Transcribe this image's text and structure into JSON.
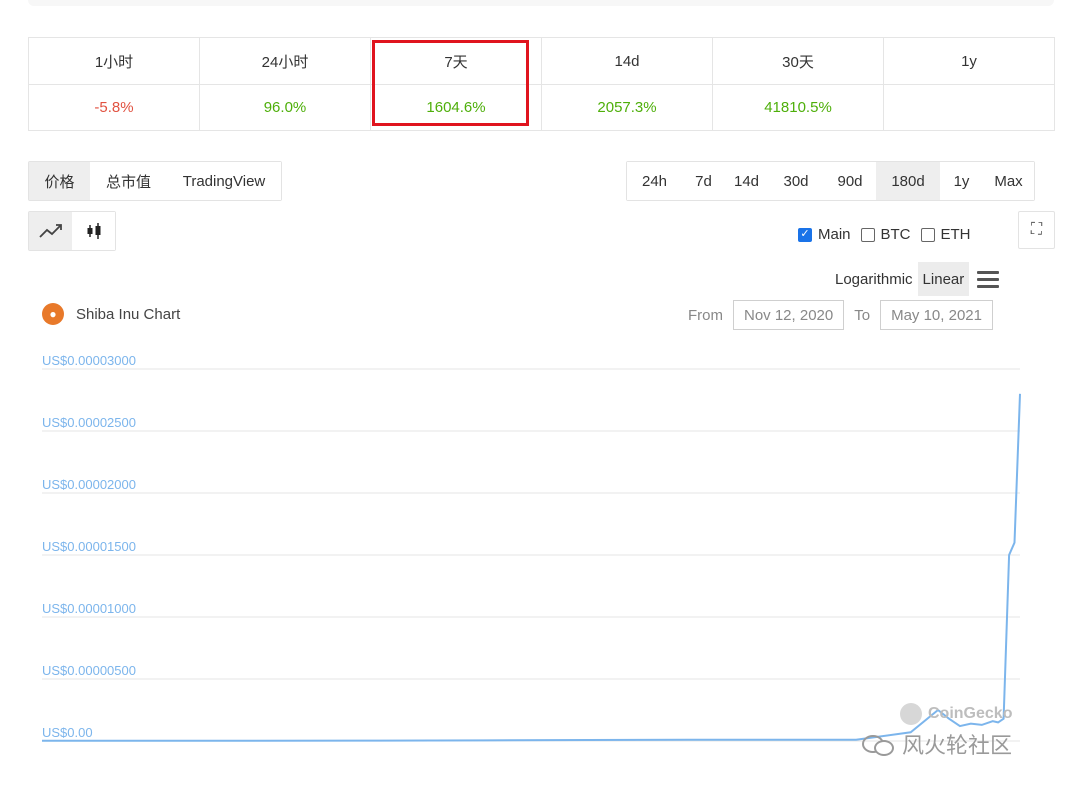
{
  "change_table": {
    "headers": [
      "1小时",
      "24小时",
      "7天",
      "14d",
      "30天",
      "1y"
    ],
    "values": [
      "-5.8%",
      "96.0%",
      "1604.6%",
      "2057.3%",
      "41810.5%",
      ""
    ]
  },
  "view_tabs": [
    "价格",
    "总市值",
    "TradingView"
  ],
  "range_tabs": [
    "24h",
    "7d",
    "14d",
    "30d",
    "90d",
    "180d",
    "1y",
    "Max"
  ],
  "range_active": "180d",
  "compare": {
    "main": "Main",
    "btc": "BTC",
    "eth": "ETH"
  },
  "scale": {
    "log": "Logarithmic",
    "linear": "Linear"
  },
  "chart_title": "Shiba Inu Chart",
  "date_range": {
    "from_label": "From",
    "from": "Nov 12, 2020",
    "to_label": "To",
    "to": "May 10, 2021"
  },
  "watermarks": {
    "coingecko": "CoinGecko",
    "wechat": "风火轮社区"
  },
  "colors": {
    "accent": "#7cb5ec",
    "highlight": "#e0141e",
    "positive": "#4eaf0a",
    "negative": "#e15241"
  },
  "chart_data": {
    "type": "line",
    "title": "Shiba Inu Chart",
    "y_tick_labels": [
      "US$0.00003000",
      "US$0.00002500",
      "US$0.00002000",
      "US$0.00001500",
      "US$0.00001000",
      "US$0.00000500",
      "US$0.00"
    ],
    "y_ticks": [
      3e-05,
      2.5e-05,
      2e-05,
      1.5e-05,
      1e-05,
      5e-06,
      0
    ],
    "ylim": [
      0,
      3e-05
    ],
    "xlim": [
      "2020-11-12",
      "2021-05-10"
    ],
    "grid": true,
    "series": [
      {
        "x": [
          "2020-11-12",
          "2020-12-01",
          "2020-12-20",
          "2021-01-10",
          "2021-02-01",
          "2021-02-20",
          "2021-03-10",
          "2021-03-30",
          "2021-04-10",
          "2021-04-20",
          "2021-04-25",
          "2021-04-27",
          "2021-04-29",
          "2021-05-01",
          "2021-05-03",
          "2021-05-05",
          "2021-05-06",
          "2021-05-07",
          "2021-05-08",
          "2021-05-09",
          "2021-05-10"
        ],
        "values": [
          2e-08,
          2e-08,
          2e-08,
          3e-08,
          5e-08,
          8e-08,
          1e-07,
          1e-07,
          1e-07,
          7e-07,
          2.5e-06,
          1.8e-06,
          1.2e-06,
          1.4e-06,
          1.3e-06,
          1.6e-06,
          1.5e-06,
          1.8e-06,
          1.5e-05,
          1.6e-05,
          2.8e-05
        ]
      }
    ]
  }
}
